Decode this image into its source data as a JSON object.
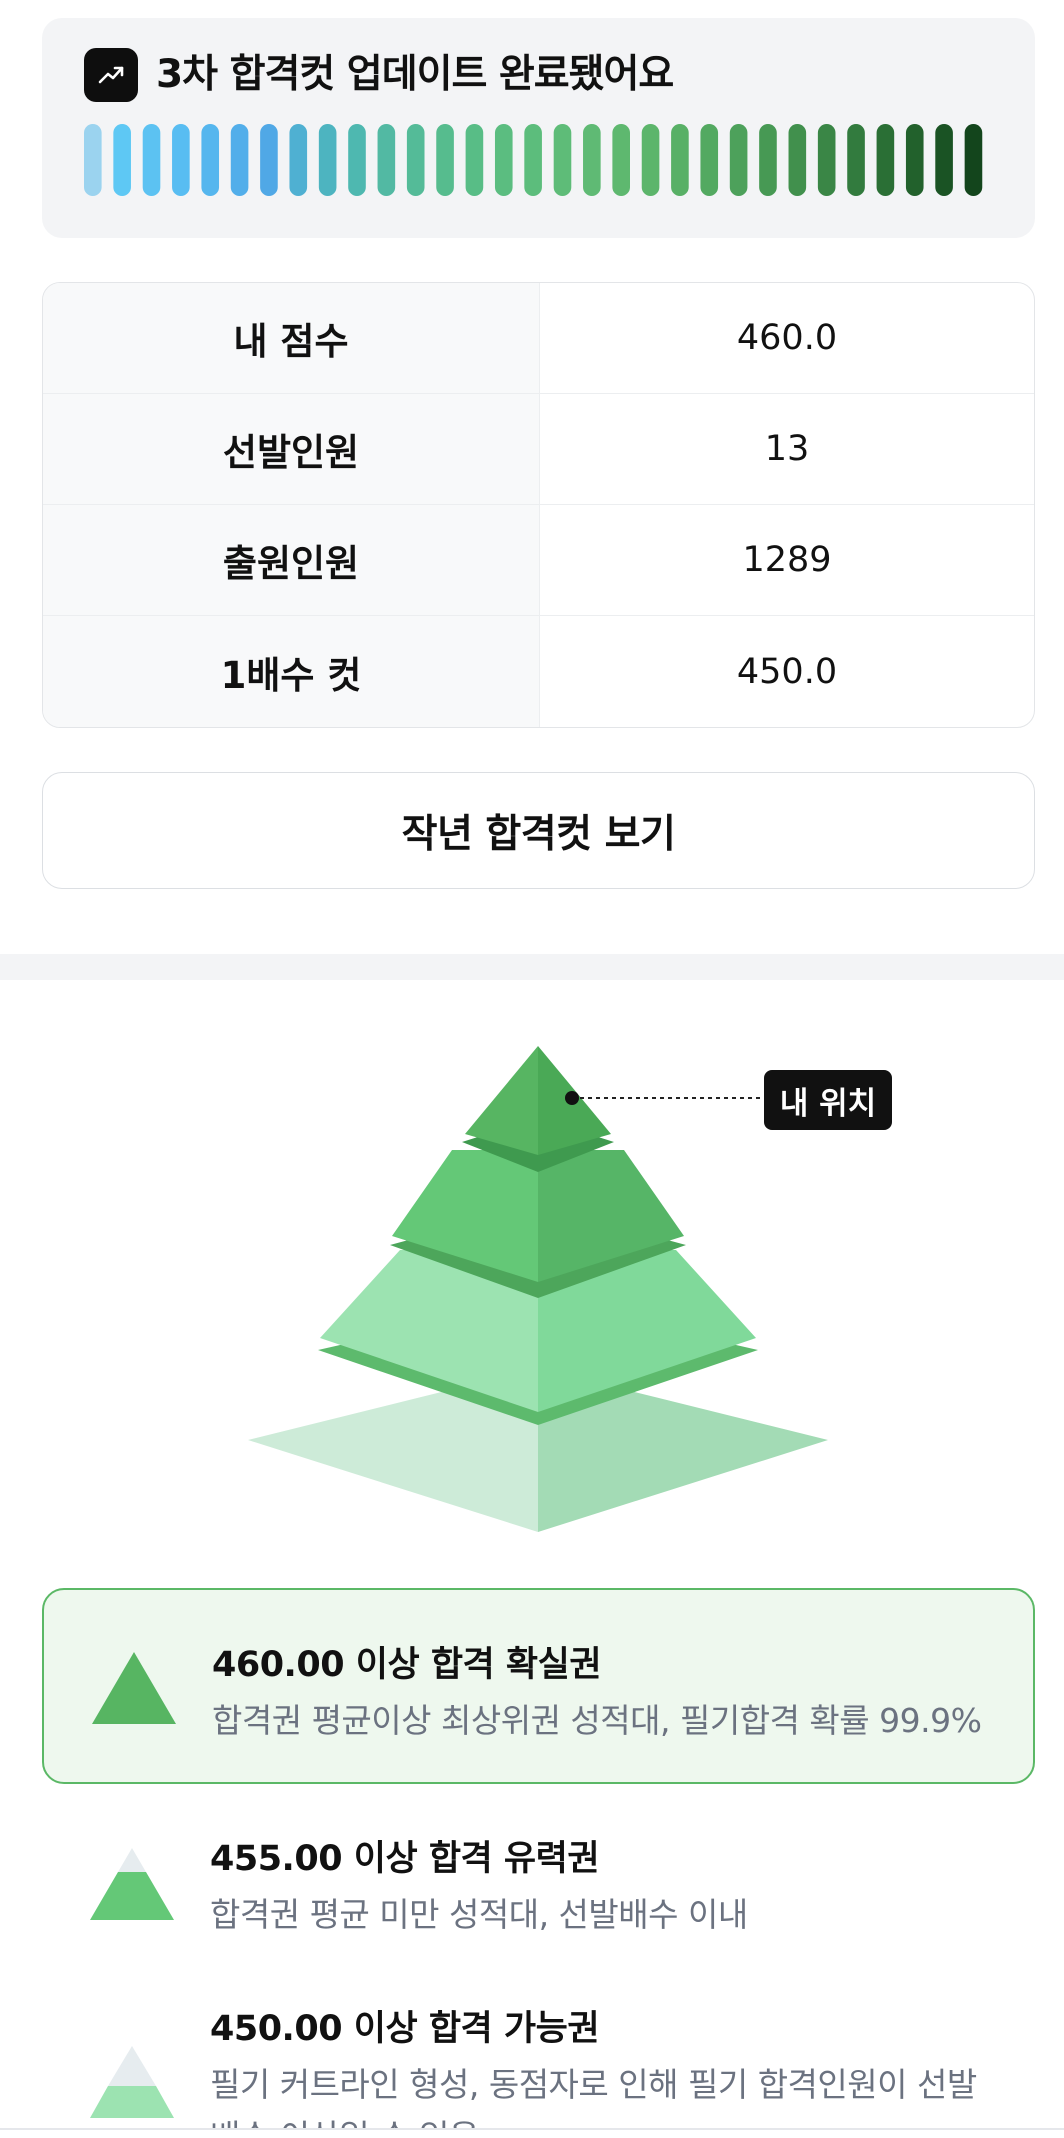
{
  "banner": {
    "title": "3차 합격컷 업데이트 완료됐어요",
    "icon": "trending-up-icon",
    "bar_colors": [
      "#9bd3ef",
      "#5ec8f4",
      "#5cc2f2",
      "#58bdf2",
      "#55b6ee",
      "#52aeea",
      "#50a8e6",
      "#4fb0d2",
      "#4db4c0",
      "#4eb8b0",
      "#52b9a3",
      "#54bb98",
      "#56bc8e",
      "#58bd86",
      "#5bbd80",
      "#5cbd7c",
      "#5ebc78",
      "#5fba74",
      "#5eb86f",
      "#5cb56b",
      "#58b066",
      "#53a961",
      "#4da15b",
      "#479954",
      "#41904d",
      "#3a8646",
      "#327b3e",
      "#2a6f35",
      "#22612c",
      "#1a5324",
      "#13451c"
    ]
  },
  "info": {
    "rows": [
      {
        "label": "내 점수",
        "value": "460.0"
      },
      {
        "label": "선발인원",
        "value": "13"
      },
      {
        "label": "출원인원",
        "value": "1289"
      },
      {
        "label": "1배수 컷",
        "value": "450.0"
      }
    ]
  },
  "last_year_button": "작년 합격컷 보기",
  "pyramid": {
    "my_position_label": "내 위치",
    "level_colors": [
      "#57b562",
      "#64c877",
      "#9ce3b1",
      "#cdebd8"
    ]
  },
  "tiers": [
    {
      "title": "460.00 이상 합격 확실권",
      "desc": "합격권 평균이상 최상위권 성적대, 필기합격 확률 99.9%",
      "active": true
    },
    {
      "title": "455.00 이상 합격 유력권",
      "desc": "합격권 평균 미만 성적대, 선발배수 이내",
      "active": false
    },
    {
      "title": "450.00 이상 합격 가능권",
      "desc": "필기 커트라인 형성, 동점자로 인해 필기 합격인원이 선발",
      "desc2": "배수 이상일 수 있음",
      "active": false
    }
  ]
}
